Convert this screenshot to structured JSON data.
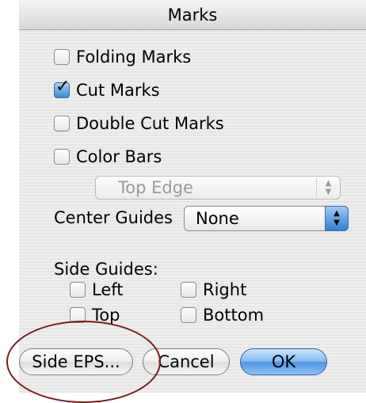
{
  "window": {
    "title": "Marks"
  },
  "checkboxes": [
    {
      "label": "Folding Marks",
      "checked": false
    },
    {
      "label": "Cut Marks",
      "checked": true
    },
    {
      "label": "Double Cut Marks",
      "checked": false
    },
    {
      "label": "Color Bars",
      "checked": false
    }
  ],
  "color_bars_position": {
    "value": "Top Edge",
    "enabled": false
  },
  "center_guides": {
    "label": "Center Guides",
    "value": "None"
  },
  "side_guides": {
    "label": "Side Guides:",
    "options": [
      {
        "label": "Left",
        "checked": false
      },
      {
        "label": "Right",
        "checked": false
      },
      {
        "label": "Top",
        "checked": false
      },
      {
        "label": "Bottom",
        "checked": false
      }
    ]
  },
  "buttons": {
    "side_eps": "Side EPS...",
    "cancel": "Cancel",
    "ok": "OK"
  },
  "colors": {
    "accent": "#3c88d6",
    "annotation": "#7a1a1a"
  },
  "icons": {
    "check": "checkmark-icon",
    "popup_arrows": "up-down-arrows-icon"
  }
}
